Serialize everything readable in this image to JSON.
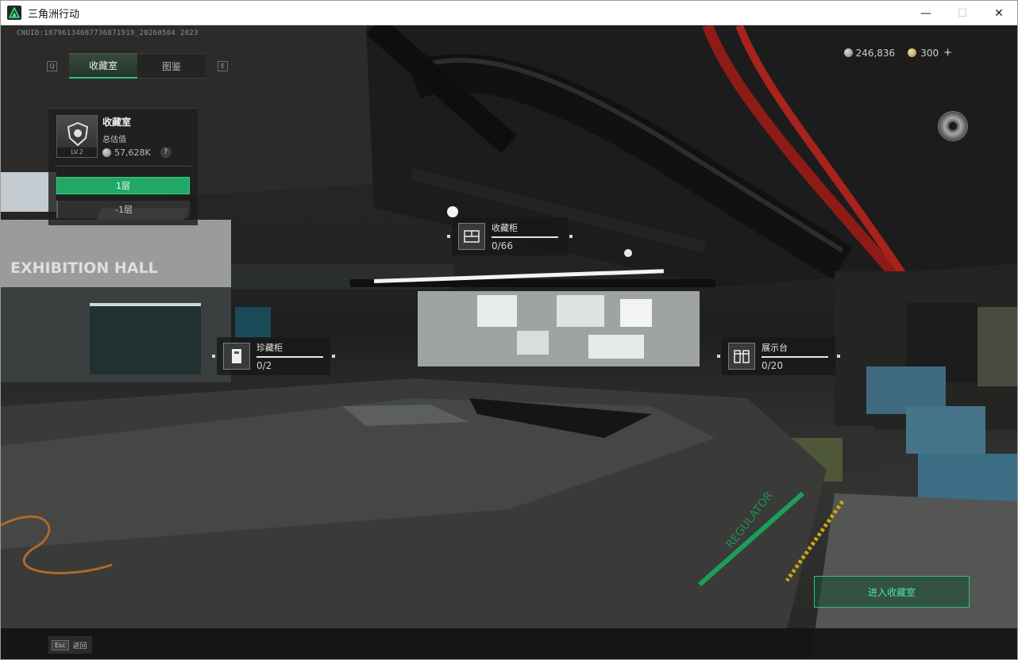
{
  "window": {
    "title": "三角洲行动",
    "minimize": "—",
    "maximize": "☐",
    "close": "✕"
  },
  "hud": {
    "uid": "CNUID:18796134687736871919_20260504 2023",
    "tab_left_key": "Q",
    "tab_right_key": "E",
    "tabs": [
      {
        "label": "收藏室",
        "active": true
      },
      {
        "label": "图鉴",
        "active": false
      }
    ],
    "currency": {
      "silver": "246,836",
      "gold": "300",
      "add": "+"
    }
  },
  "panel": {
    "badge_level": "LV.2",
    "title": "收藏室",
    "subtitle": "总估值",
    "value": "57,628K",
    "help": "?",
    "floors": [
      {
        "label": "1层",
        "active": true
      },
      {
        "label": "-1层",
        "active": false
      }
    ]
  },
  "scene": {
    "wall_text": "EXHIBITION HALL",
    "floor_text": "REGULATOR"
  },
  "markers": [
    {
      "name": "收藏柜",
      "count": "0/66",
      "icon": "cabinet-icon"
    },
    {
      "name": "珍藏柜",
      "count": "0/2",
      "icon": "vault-icon"
    },
    {
      "name": "展示台",
      "count": "0/20",
      "icon": "display-stand-icon"
    }
  ],
  "enter_button": "进入收藏室",
  "bottom": {
    "esc_key": "Esc",
    "esc_label": "返回"
  },
  "colors": {
    "accent_green": "#2fc47e",
    "floor_active": "#22a866",
    "enter_text": "#4ee59a"
  }
}
